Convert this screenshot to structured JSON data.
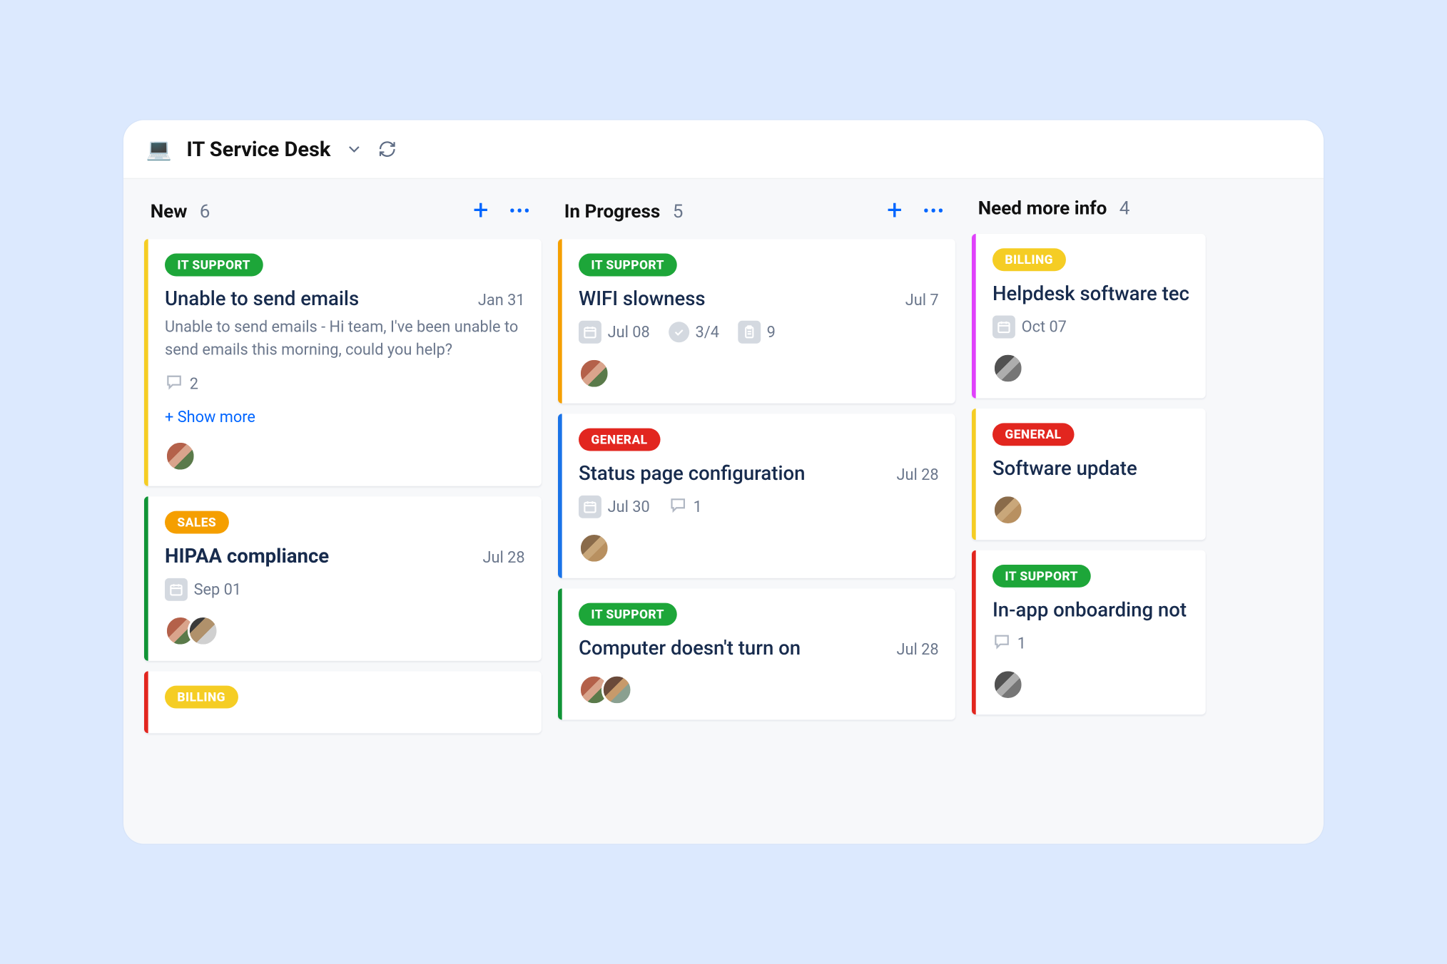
{
  "board": {
    "emoji": "💻",
    "title": "IT Service Desk"
  },
  "columns": [
    {
      "name": "New",
      "count": "6",
      "show_actions": true,
      "cards": [
        {
          "stripe": "yellow",
          "tag": {
            "text": "IT SUPPORT",
            "color": "green"
          },
          "title": "Unable to send emails",
          "title_bold": false,
          "date": "Jan 31",
          "desc": "Unable to send emails - Hi team, I've been unable to send emails this morning, could you help?",
          "meta": [
            {
              "icon": "comment",
              "value": "2"
            }
          ],
          "show_more": "+ Show more",
          "avatars": [
            "av1"
          ]
        },
        {
          "stripe": "green",
          "tag": {
            "text": "SALES",
            "color": "orange"
          },
          "title": "HIPAA compliance",
          "title_bold": true,
          "date": "Jul 28",
          "meta": [
            {
              "icon": "calendar",
              "value": "Sep 01"
            }
          ],
          "avatars": [
            "av1",
            "av3"
          ]
        },
        {
          "stripe": "red",
          "tag": {
            "text": "BILLING",
            "color": "yellow"
          },
          "title": "",
          "title_bold": false,
          "avatars": []
        }
      ]
    },
    {
      "name": "In Progress",
      "count": "5",
      "show_actions": true,
      "cards": [
        {
          "stripe": "orange",
          "tag": {
            "text": "IT SUPPORT",
            "color": "green"
          },
          "title": "WIFI slowness",
          "title_bold": false,
          "date": "Jul 7",
          "meta": [
            {
              "icon": "calendar",
              "value": "Jul 08"
            },
            {
              "icon": "check",
              "value": "3/4"
            },
            {
              "icon": "clipboard",
              "value": "9"
            }
          ],
          "avatars": [
            "av1"
          ]
        },
        {
          "stripe": "blue",
          "tag": {
            "text": "GENERAL",
            "color": "red"
          },
          "title": "Status page configuration",
          "title_bold": false,
          "date": "Jul 28",
          "meta": [
            {
              "icon": "calendar",
              "value": "Jul 30"
            },
            {
              "icon": "comment",
              "value": "1"
            }
          ],
          "avatars": [
            "av2"
          ]
        },
        {
          "stripe": "green",
          "tag": {
            "text": "IT SUPPORT",
            "color": "green"
          },
          "title": "Computer doesn't turn on",
          "title_bold": false,
          "date": "Jul 28",
          "avatars": [
            "av1",
            "av4"
          ]
        }
      ]
    },
    {
      "name": "Need more info",
      "count": "4",
      "show_actions": false,
      "cards": [
        {
          "stripe": "pink",
          "tag": {
            "text": "BILLING",
            "color": "yellow"
          },
          "title": "Helpdesk software tec",
          "title_bold": false,
          "meta": [
            {
              "icon": "calendar",
              "value": "Oct 07"
            }
          ],
          "avatars": [
            "av-gray"
          ]
        },
        {
          "stripe": "yellow",
          "tag": {
            "text": "GENERAL",
            "color": "red"
          },
          "title": "Software update",
          "title_bold": false,
          "avatars": [
            "av2"
          ]
        },
        {
          "stripe": "red",
          "tag": {
            "text": "IT SUPPORT",
            "color": "green"
          },
          "title": "In-app onboarding not",
          "title_bold": false,
          "meta": [
            {
              "icon": "comment",
              "value": "1"
            }
          ],
          "avatars": [
            "av-gray"
          ]
        }
      ]
    }
  ]
}
